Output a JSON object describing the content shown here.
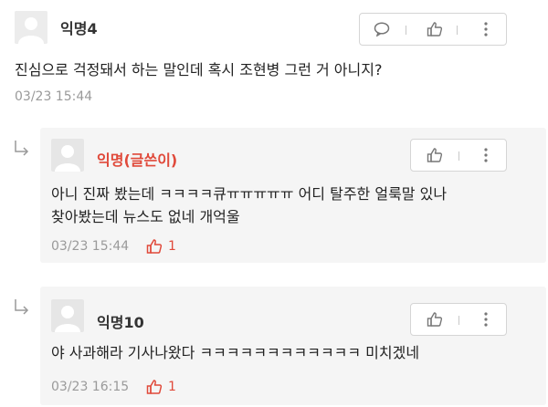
{
  "comments": [
    {
      "author": "익명4",
      "text": "진심으로 걱정돼서 하는 말인데 혹시 조현병 그런 거 아니지?",
      "timestamp": "03/23 15:44"
    }
  ],
  "replies": [
    {
      "author": "익명(글쓴이)",
      "lines": [
        "아니 진짜 봤는데 ㅋㅋㅋㅋ큐ㅠㅠㅠㅠㅠ 어디 탈주한 얼룩말 있나",
        "찾아봤는데 뉴스도 없네 개억울"
      ],
      "timestamp": "03/23 15:44",
      "likes": "1"
    },
    {
      "author": "익명10",
      "lines": [
        "야 사과해라 기사나왔다 ㅋㅋㅋㅋㅋㅋㅋㅋㅋㅋㅋㅋ 미치겠네"
      ],
      "timestamp": "03/23 16:15",
      "likes": "1"
    }
  ],
  "colors": {
    "writer": "#e0493a",
    "like_active": "#e0493a",
    "reply_bg": "#f5f5f5"
  },
  "icons": [
    "comment-icon",
    "thumbs-up-icon",
    "more-icon",
    "reply-arrow-icon",
    "avatar-icon"
  ]
}
